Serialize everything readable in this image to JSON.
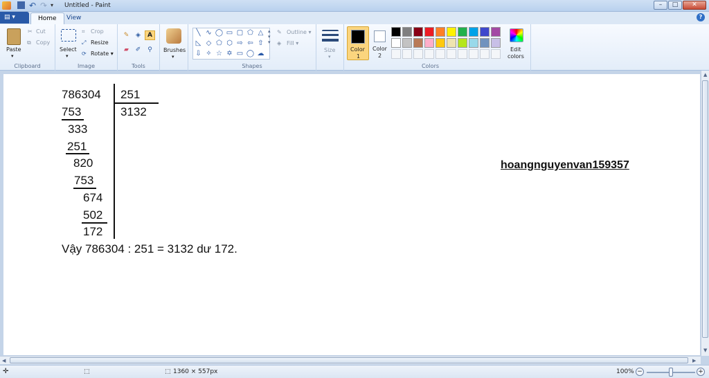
{
  "titlebar": {
    "title": "Untitled - Paint",
    "min": "–",
    "max": "□",
    "close": "✕"
  },
  "tabs": {
    "file": "▤ ▾",
    "home": "Home",
    "view": "View",
    "help": "?"
  },
  "ribbon": {
    "clipboard": {
      "label": "Clipboard",
      "paste": "Paste",
      "cut": "Cut",
      "copy": "Copy"
    },
    "image": {
      "label": "Image",
      "select": "Select",
      "crop": "Crop",
      "resize": "Resize",
      "rotate": "Rotate ▾"
    },
    "tools": {
      "label": "Tools"
    },
    "brushes": {
      "label": "Brushes"
    },
    "shapes": {
      "label": "Shapes",
      "outline": "Outline ▾",
      "fill": "Fill ▾"
    },
    "size": {
      "label": "Size"
    },
    "colors": {
      "label": "Colors",
      "color1": "Color\n1",
      "color1_l1": "Color",
      "color1_l2": "1",
      "color2_l1": "Color",
      "color2_l2": "2",
      "edit_l1": "Edit",
      "edit_l2": "colors",
      "row1": [
        "#000000",
        "#7f7f7f",
        "#880015",
        "#ed1c24",
        "#ff7f27",
        "#fff200",
        "#22b14c",
        "#00a2e8",
        "#3f48cc",
        "#a349a4"
      ],
      "row2": [
        "#ffffff",
        "#c3c3c3",
        "#b97a57",
        "#ffaec9",
        "#ffc90e",
        "#efe4b0",
        "#b5e61d",
        "#99d9ea",
        "#7092be",
        "#c8bfe7"
      ]
    }
  },
  "canvas": {
    "lines": {
      "dividend": "786304",
      "divisor": "251",
      "quotient": "3132",
      "s1": "753",
      "r1": "333",
      "s2": "251",
      "r2": "820",
      "s3": "753",
      "r3": "674",
      "s4": "502",
      "r4": "172",
      "conclusion": "Vậy 786304 : 251 = 3132 dư 172."
    },
    "watermark": "hoangnguyenvan159357"
  },
  "status": {
    "dimensions": "1360 × 557px",
    "zoom": "100%",
    "minus": "−",
    "plus": "+"
  }
}
